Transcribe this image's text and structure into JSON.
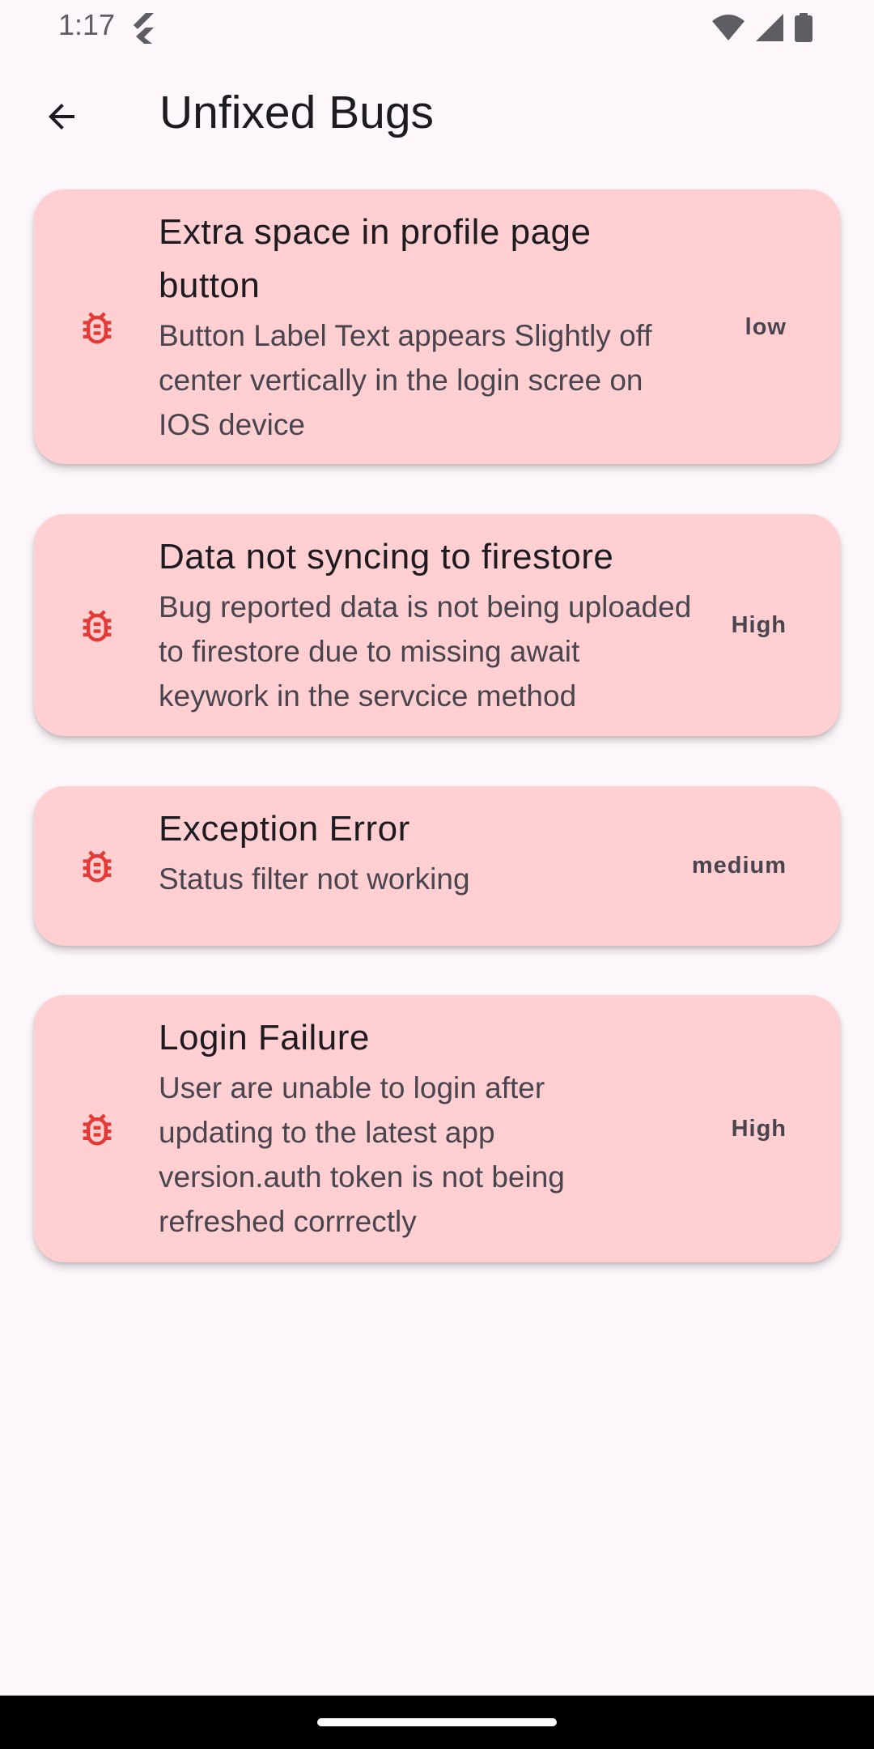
{
  "status_bar": {
    "time": "1:17",
    "icons": [
      "flutter-icon",
      "wifi-icon",
      "signal-icon",
      "battery-icon"
    ]
  },
  "app_bar": {
    "back_icon": "arrow-back-icon",
    "title": "Unfixed Bugs"
  },
  "colors": {
    "background": "#fdf7fb",
    "card": "#ffcfd1",
    "bug_icon": "#e53935",
    "title_text": "#1d1b20",
    "secondary_text": "#49454f"
  },
  "bugs": [
    {
      "icon": "bug-icon",
      "title": "Extra space in profile page button",
      "description": "Button Label Text appears Slightly off center vertically in the login scree on IOS device",
      "priority": "low"
    },
    {
      "icon": "bug-icon",
      "title": "Data not syncing to firestore",
      "description": "Bug reported data is not being uploaded to firestore due to missing await keywork in the servcice method",
      "priority": "High"
    },
    {
      "icon": "bug-icon",
      "title": "Exception Error",
      "description": "Status filter not working",
      "priority": "medium"
    },
    {
      "icon": "bug-icon",
      "title": "Login Failure",
      "description": "User are unable to login after updating to the latest app version.auth token is not being refreshed corrrectly",
      "priority": "High"
    }
  ]
}
